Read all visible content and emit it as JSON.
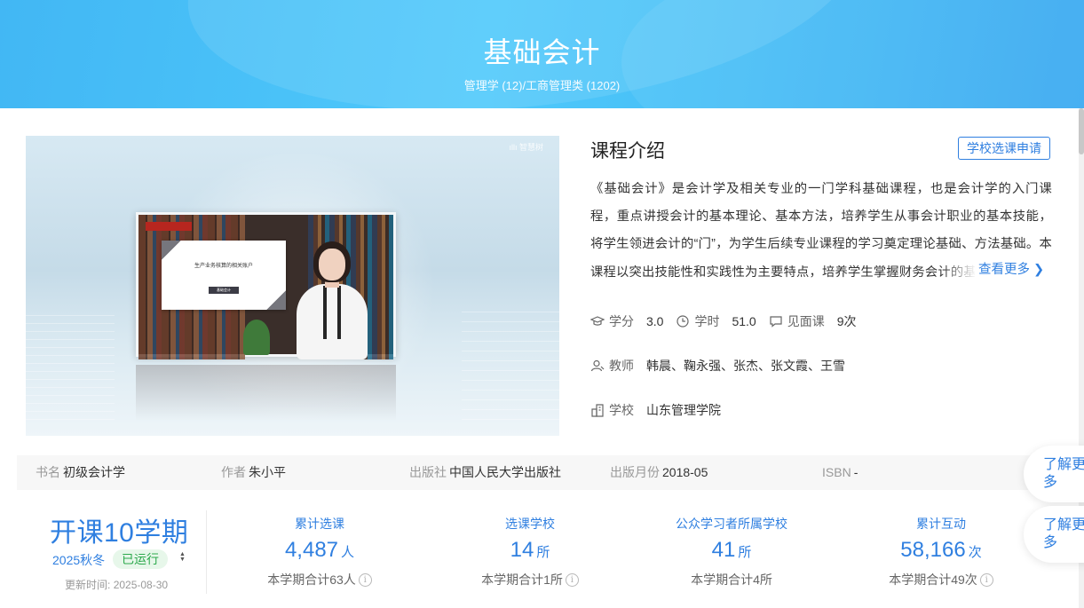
{
  "course": {
    "title": "基础会计",
    "category": "管理学 (12)/工商管理类 (1202)"
  },
  "video": {
    "watermark": "ıllı 智慧树",
    "slide_title": "生产业务核算的相关账户",
    "slide_tag": "基础会计"
  },
  "intro": {
    "heading": "课程介绍",
    "apply_button": "学校选课申请",
    "text": "《基础会计》是会计学及相关专业的一门学科基础课程，也是会计学的入门课程，重点讲授会计的基本理论、基本方法，培养学生从事会计职业的基本技能，将学生领进会计的“门”，为学生后续专业课程的学习奠定理论基础、方法基础。本课程以突出技能性和实践性为主要特点，培养学生掌握财务会计的基本技能。",
    "more_link": "查看更多 ❯"
  },
  "meta": {
    "credit_label": "学分",
    "credit_value": "3.0",
    "hours_label": "学时",
    "hours_value": "51.0",
    "meet_label": "见面课",
    "meet_value": "9次",
    "teacher_label": "教师",
    "teacher_value": "韩晨、鞠永强、张杰、张文霞、王雪",
    "school_label": "学校",
    "school_value": "山东管理学院"
  },
  "book": {
    "name_label": "书名",
    "name_value": "初级会计学",
    "author_label": "作者",
    "author_value": "朱小平",
    "publisher_label": "出版社",
    "publisher_value": "中国人民大学出版社",
    "date_label": "出版月份",
    "date_value": "2018-05",
    "isbn_label": "ISBN",
    "isbn_value": "-"
  },
  "float_buttons": {
    "learn_more_1": "了解更多",
    "learn_more_2": "了解更多"
  },
  "semester": {
    "big": "开课10学期",
    "term": "2025秋冬",
    "status": "已运行",
    "update_label": "更新时间:",
    "update_value": "2025-08-30"
  },
  "stats": [
    {
      "label": "累计选课",
      "number": "4,487",
      "unit": "人",
      "sub": "本学期合计63人"
    },
    {
      "label": "选课学校",
      "number": "14",
      "unit": "所",
      "sub": "本学期合计1所"
    },
    {
      "label": "公众学习者所属学校",
      "number": "41",
      "unit": "所",
      "sub": "本学期合计4所"
    },
    {
      "label": "累计互动",
      "number": "58,166",
      "unit": "次",
      "sub": "本学期合计49次"
    }
  ],
  "colors": {
    "accent": "#2f7fe0",
    "banner": "#4fc9fb",
    "status_green": "#2ca94c"
  }
}
